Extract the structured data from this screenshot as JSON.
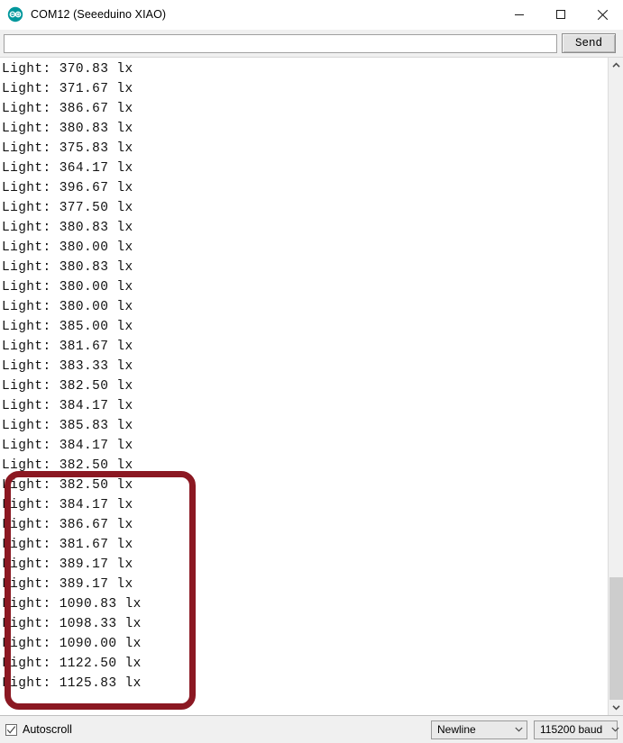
{
  "window": {
    "title": "COM12 (Seeeduino XIAO)",
    "icon": "arduino-infinity-icon",
    "controls": {
      "minimize": "minimize-icon",
      "maximize": "maximize-icon",
      "close": "close-icon"
    }
  },
  "command_bar": {
    "input_value": "",
    "input_placeholder": "",
    "send_label": "Send"
  },
  "output": {
    "lines": [
      "Light: 370.83 lx",
      "Light: 371.67 lx",
      "Light: 386.67 lx",
      "Light: 380.83 lx",
      "Light: 375.83 lx",
      "Light: 364.17 lx",
      "Light: 396.67 lx",
      "Light: 377.50 lx",
      "Light: 380.83 lx",
      "Light: 380.00 lx",
      "Light: 380.83 lx",
      "Light: 380.00 lx",
      "Light: 380.00 lx",
      "Light: 385.00 lx",
      "Light: 381.67 lx",
      "Light: 383.33 lx",
      "Light: 382.50 lx",
      "Light: 384.17 lx",
      "Light: 385.83 lx",
      "Light: 384.17 lx",
      "Light: 382.50 lx",
      "Light: 382.50 lx",
      "Light: 384.17 lx",
      "Light: 386.67 lx",
      "Light: 381.67 lx",
      "Light: 389.17 lx",
      "Light: 389.17 lx",
      "Light: 1090.83 lx",
      "Light: 1098.33 lx",
      "Light: 1090.00 lx",
      "Light: 1122.50 lx",
      "Light: 1125.83 lx"
    ]
  },
  "annotation": {
    "color": "#8b1822",
    "shape": "rounded-rectangle"
  },
  "status_bar": {
    "autoscroll_label": "Autoscroll",
    "autoscroll_checked": true,
    "line_ending": "Newline",
    "baud_rate": "115200 baud"
  }
}
